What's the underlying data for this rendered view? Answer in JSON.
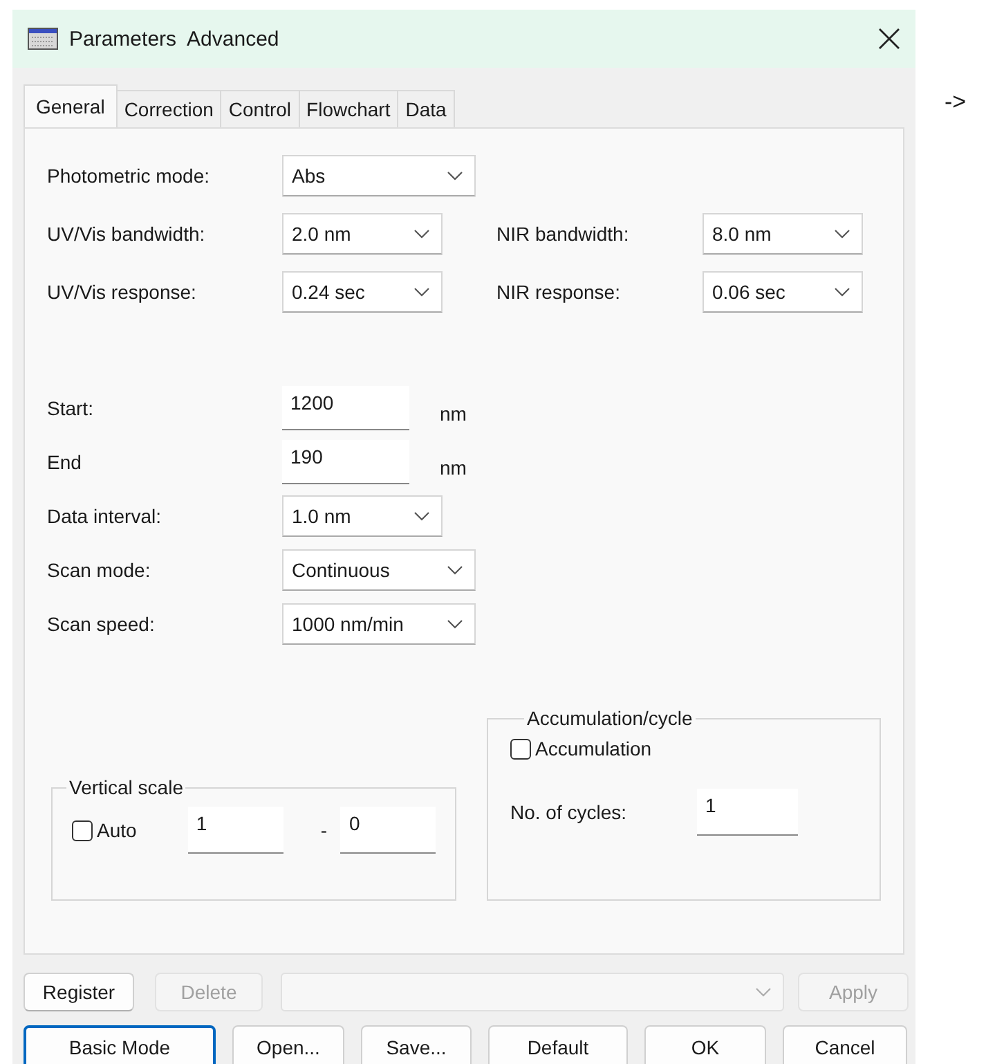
{
  "window": {
    "title": "Parameters  Advanced"
  },
  "tabs": [
    {
      "label": "General",
      "selected": true
    },
    {
      "label": "Correction",
      "selected": false
    },
    {
      "label": "Control",
      "selected": false
    },
    {
      "label": "Flowchart",
      "selected": false
    },
    {
      "label": "Data",
      "selected": false
    }
  ],
  "detector_settings": [
    {
      "label": "Photometric mode:",
      "value": "Abs"
    },
    {
      "label": "UV/Vis bandwidth:",
      "value": "2.0 nm",
      "right": {
        "label": "NIR bandwidth:",
        "value": "8.0 nm"
      }
    },
    {
      "label": "UV/Vis response:",
      "value": "0.24 sec",
      "right": {
        "label": "NIR response:",
        "value": "0.06 sec"
      }
    }
  ],
  "scan_settings": [
    {
      "kind": "number",
      "label": "Start:",
      "value": "1200",
      "unit": "nm"
    },
    {
      "kind": "number",
      "label": "End",
      "value": "190",
      "unit": "nm"
    },
    {
      "kind": "select",
      "label": "Data interval:",
      "value": "1.0 nm"
    },
    {
      "kind": "select",
      "label": "Scan mode:",
      "value": "Continuous"
    },
    {
      "kind": "select",
      "label": "Scan speed:",
      "value": "1000 nm/min"
    }
  ],
  "vertical_scale": {
    "title": "Vertical scale",
    "auto": {
      "label": "Auto",
      "checked": false
    },
    "from": "1",
    "separator": "-",
    "to": "0"
  },
  "accumulation_cycle": {
    "title": "Accumulation/cycle",
    "accumulation": {
      "label": "Accumulation",
      "checked": false
    },
    "cycles_label": "No. of cycles:",
    "cycles": "1"
  },
  "preset_row": {
    "register": {
      "label": "Register",
      "disabled": false
    },
    "delete": {
      "label": "Delete",
      "disabled": true
    },
    "combo": {
      "disabled": true
    },
    "apply": {
      "label": "Apply",
      "disabled": true
    }
  },
  "dialog_buttons": [
    {
      "label": "Basic Mode",
      "focused": true
    },
    {
      "label": "Open...",
      "focused": false
    },
    {
      "label": "Save...",
      "focused": false
    },
    {
      "label": "Default",
      "focused": false
    },
    {
      "label": "OK",
      "focused": false
    },
    {
      "label": "Cancel",
      "focused": false
    }
  ],
  "side_note": "->"
}
